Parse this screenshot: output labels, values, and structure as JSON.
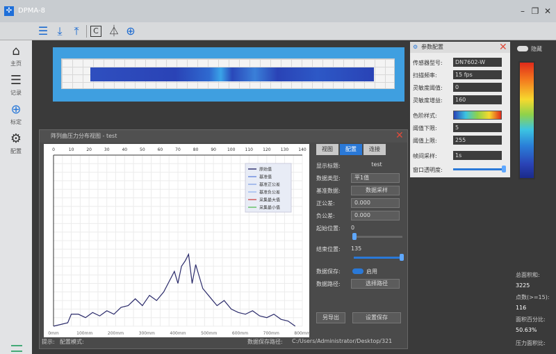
{
  "window": {
    "title": "DPMA-8"
  },
  "sidebar": {
    "items": [
      {
        "label": "主页",
        "icon": "home-icon"
      },
      {
        "label": "记录",
        "icon": "database-icon"
      },
      {
        "label": "标定",
        "icon": "target-icon"
      },
      {
        "label": "配置",
        "icon": "settings-icon"
      }
    ]
  },
  "panel": {
    "title": "阵列曲压力分布视图 - test",
    "tabs": [
      "视图",
      "配置",
      "连接"
    ],
    "fields": [
      {
        "label": "显示标题:",
        "value": "test"
      },
      {
        "label": "数据类型:",
        "value": "平1值"
      },
      {
        "label": "基准数据:",
        "value": "数据采样"
      },
      {
        "label": "正公差:",
        "value": "0.000"
      },
      {
        "label": "负公差:",
        "value": "0.000"
      }
    ],
    "start_label": "起始位置:",
    "start_value": "0",
    "end_label": "结束位置:",
    "end_value": "135",
    "save_label": "数据保存:",
    "save_toggle": "启用",
    "path_label": "数据路径:",
    "path_button": "选择路径",
    "import_button": "另导出",
    "save_settings_button": "设置保存"
  },
  "status": {
    "hint_label": "提示:",
    "hint_value": "配置模式:",
    "path_label": "数据保存路径:",
    "path_value": "C:/Users/Administrator/Desktop/321"
  },
  "config": {
    "title": "参数配置",
    "fields": [
      {
        "label": "传感器型号:",
        "value": "DN7602-W"
      },
      {
        "label": "扫描频率:",
        "value": "15 fps"
      },
      {
        "label": "灵敏度阈值:",
        "value": "0"
      },
      {
        "label": "灵敏度增益:",
        "value": "160"
      }
    ],
    "color_label": "色阶样式:",
    "threshold_low_label": "阈值下限:",
    "threshold_low": "5",
    "threshold_high_label": "阈值上限:",
    "threshold_high": "255",
    "sample_label": "帧间采样:",
    "sample_value": "1s",
    "transparency_label": "窗口透明度:"
  },
  "right": {
    "toggle_label": "隐藏",
    "stats": [
      {
        "label": "总面积和:",
        "value": "3225"
      },
      {
        "label": "点数(>=15):",
        "value": "116"
      },
      {
        "label": "面积百分比:",
        "value": "50.63%"
      },
      {
        "label": "压力面积比:",
        "value": ""
      }
    ]
  },
  "chart_data": {
    "type": "line",
    "x_top_ticks": [
      "0",
      "10",
      "20",
      "30",
      "40",
      "50",
      "60",
      "70",
      "80",
      "90",
      "100",
      "110",
      "120",
      "130",
      "140"
    ],
    "x_bottom_ticks": [
      "0mm",
      "100mm",
      "200mm",
      "300mm",
      "400mm",
      "500mm",
      "600mm",
      "700mm",
      "800mm"
    ],
    "xlim": [
      0,
      140
    ],
    "ylim": [
      0,
      1
    ],
    "legend": [
      "原始值",
      "基准值",
      "基准正公差",
      "基准负公差",
      "采集最大值",
      "采集最小值"
    ],
    "series": [
      {
        "name": "原始值",
        "color": "#2a2a6a",
        "x": [
          0,
          8,
          10,
          14,
          18,
          22,
          26,
          30,
          34,
          38,
          42,
          46,
          50,
          54,
          58,
          62,
          66,
          68,
          70,
          72,
          74,
          76,
          78,
          80,
          84,
          88,
          92,
          96,
          100,
          104,
          108,
          112,
          116,
          120,
          124,
          128,
          132,
          136
        ],
        "y": [
          0.0,
          0.02,
          0.07,
          0.07,
          0.05,
          0.08,
          0.06,
          0.09,
          0.07,
          0.11,
          0.12,
          0.16,
          0.12,
          0.18,
          0.15,
          0.2,
          0.28,
          0.32,
          0.25,
          0.35,
          0.38,
          0.42,
          0.25,
          0.36,
          0.22,
          0.17,
          0.12,
          0.15,
          0.1,
          0.08,
          0.07,
          0.09,
          0.06,
          0.05,
          0.07,
          0.04,
          0.03,
          0.0
        ]
      }
    ]
  }
}
